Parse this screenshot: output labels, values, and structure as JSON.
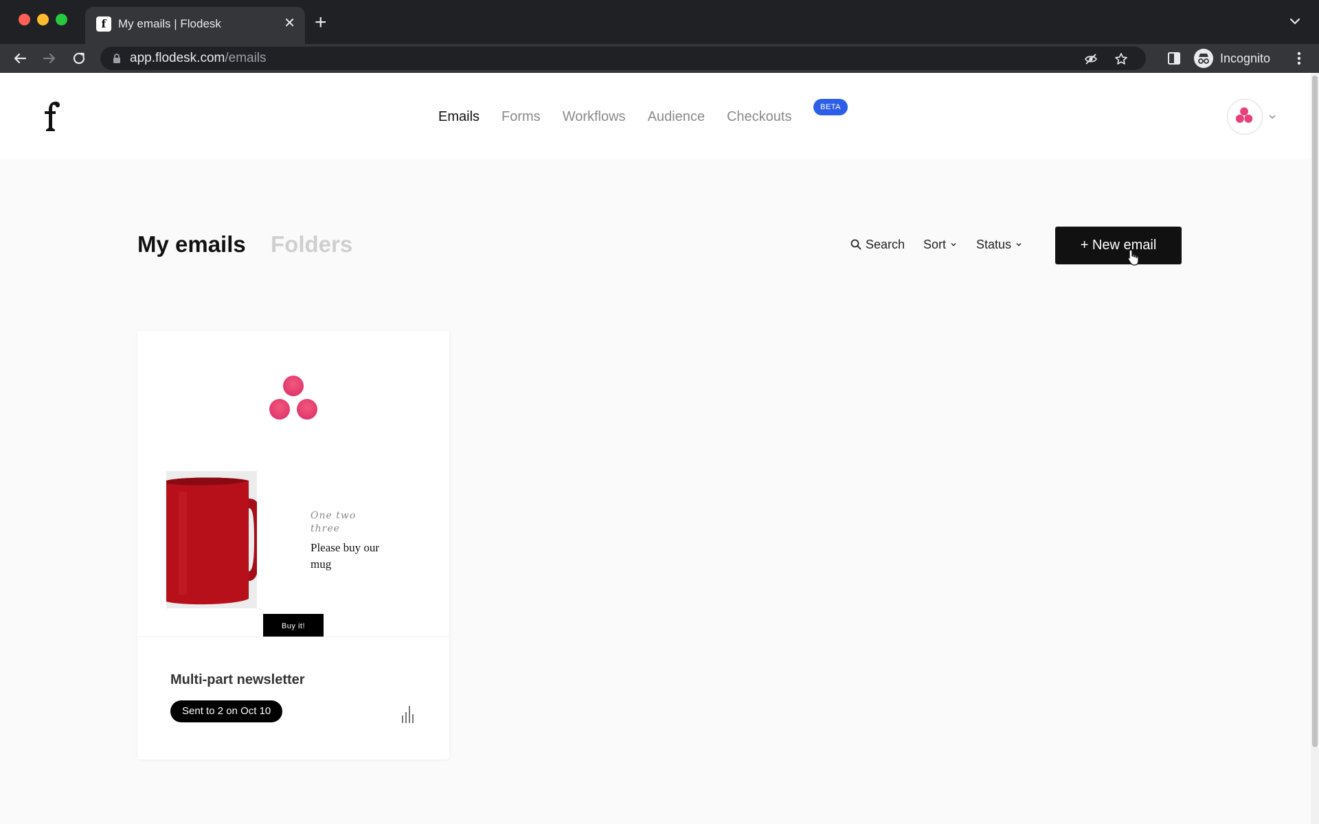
{
  "browser": {
    "tab_title": "My emails | Flodesk",
    "tab_close": "✕",
    "new_tab": "+",
    "url_host": "app.flodesk.com",
    "url_path": "/emails",
    "profile_label": "Incognito"
  },
  "header": {
    "nav": [
      "Emails",
      "Forms",
      "Workflows",
      "Audience",
      "Checkouts"
    ],
    "active_nav": "Emails",
    "beta_badge": "BETA"
  },
  "page": {
    "title": "My emails",
    "folders_tab": "Folders",
    "search_label": "Search",
    "sort_label": "Sort",
    "status_label": "Status",
    "new_email_label": "+ New email"
  },
  "emails": [
    {
      "name": "Multi-part newsletter",
      "status": "Sent to 2 on Oct 10",
      "preview": {
        "script_text": "One two three",
        "body_text": "Please buy our mug",
        "button_label": "Buy it!"
      }
    }
  ],
  "colors": {
    "accent": "#2c5ee7",
    "primary_button": "#111111",
    "brand_pink": "#e8407a",
    "mug_red": "#b8101b"
  }
}
